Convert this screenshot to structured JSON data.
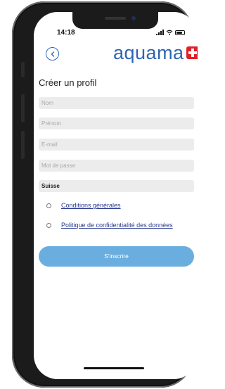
{
  "status_bar": {
    "time": "14:18"
  },
  "header": {
    "logo_text": "aquama",
    "brand_color": "#2f66b2",
    "cross_color": "#e21e26"
  },
  "page": {
    "title": "Créer un profil"
  },
  "form": {
    "name_placeholder": "Nom",
    "first_name_placeholder": "Prénom",
    "email_placeholder": "E-mail",
    "password_placeholder": "Mot de passe",
    "country_value": "Suisse"
  },
  "agreements": {
    "terms_label": "Conditions générales",
    "privacy_label": "Politique de confidentialité des données"
  },
  "actions": {
    "submit_label": "S'inscrire",
    "submit_color": "#6aaee0"
  }
}
